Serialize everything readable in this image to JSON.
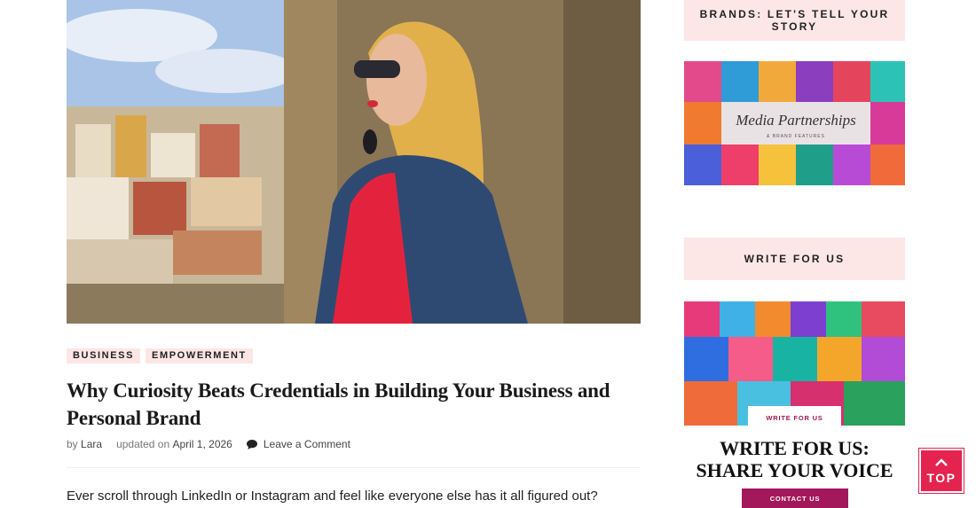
{
  "post": {
    "hero_alt": "Woman with sunglasses and denim jacket leaning on a stone wall above a city",
    "categories": [
      "BUSINESS",
      "EMPOWERMENT"
    ],
    "title": "Why Curiosity Beats Credentials in Building Your Business and Personal Brand",
    "meta": {
      "by": "by",
      "author": "Lara",
      "updated_prefix": "updated on",
      "date": "April 1, 2026",
      "comment_link": "Leave a Comment"
    },
    "excerpt": "Ever scroll through LinkedIn or Instagram and feel like everyone else has it all figured out?"
  },
  "sidebar": {
    "brands_heading": "BRANDS: LET'S TELL YOUR STORY",
    "media_banner": {
      "script_text": "Media Partnerships",
      "sub_text": "& BRAND FEATURES"
    },
    "write_heading": "WRITE FOR US",
    "write_banner": {
      "tag": "WRITE FOR US",
      "headline_line1": "WRITE FOR US:",
      "headline_line2": "SHARE YOUR VOICE",
      "cta": "CONTACT US"
    }
  },
  "top_button": {
    "label": "TOP"
  },
  "colors": {
    "accent": "#e4234e",
    "pill_bg": "#fde6e6",
    "cta_bg": "#a3185a"
  }
}
